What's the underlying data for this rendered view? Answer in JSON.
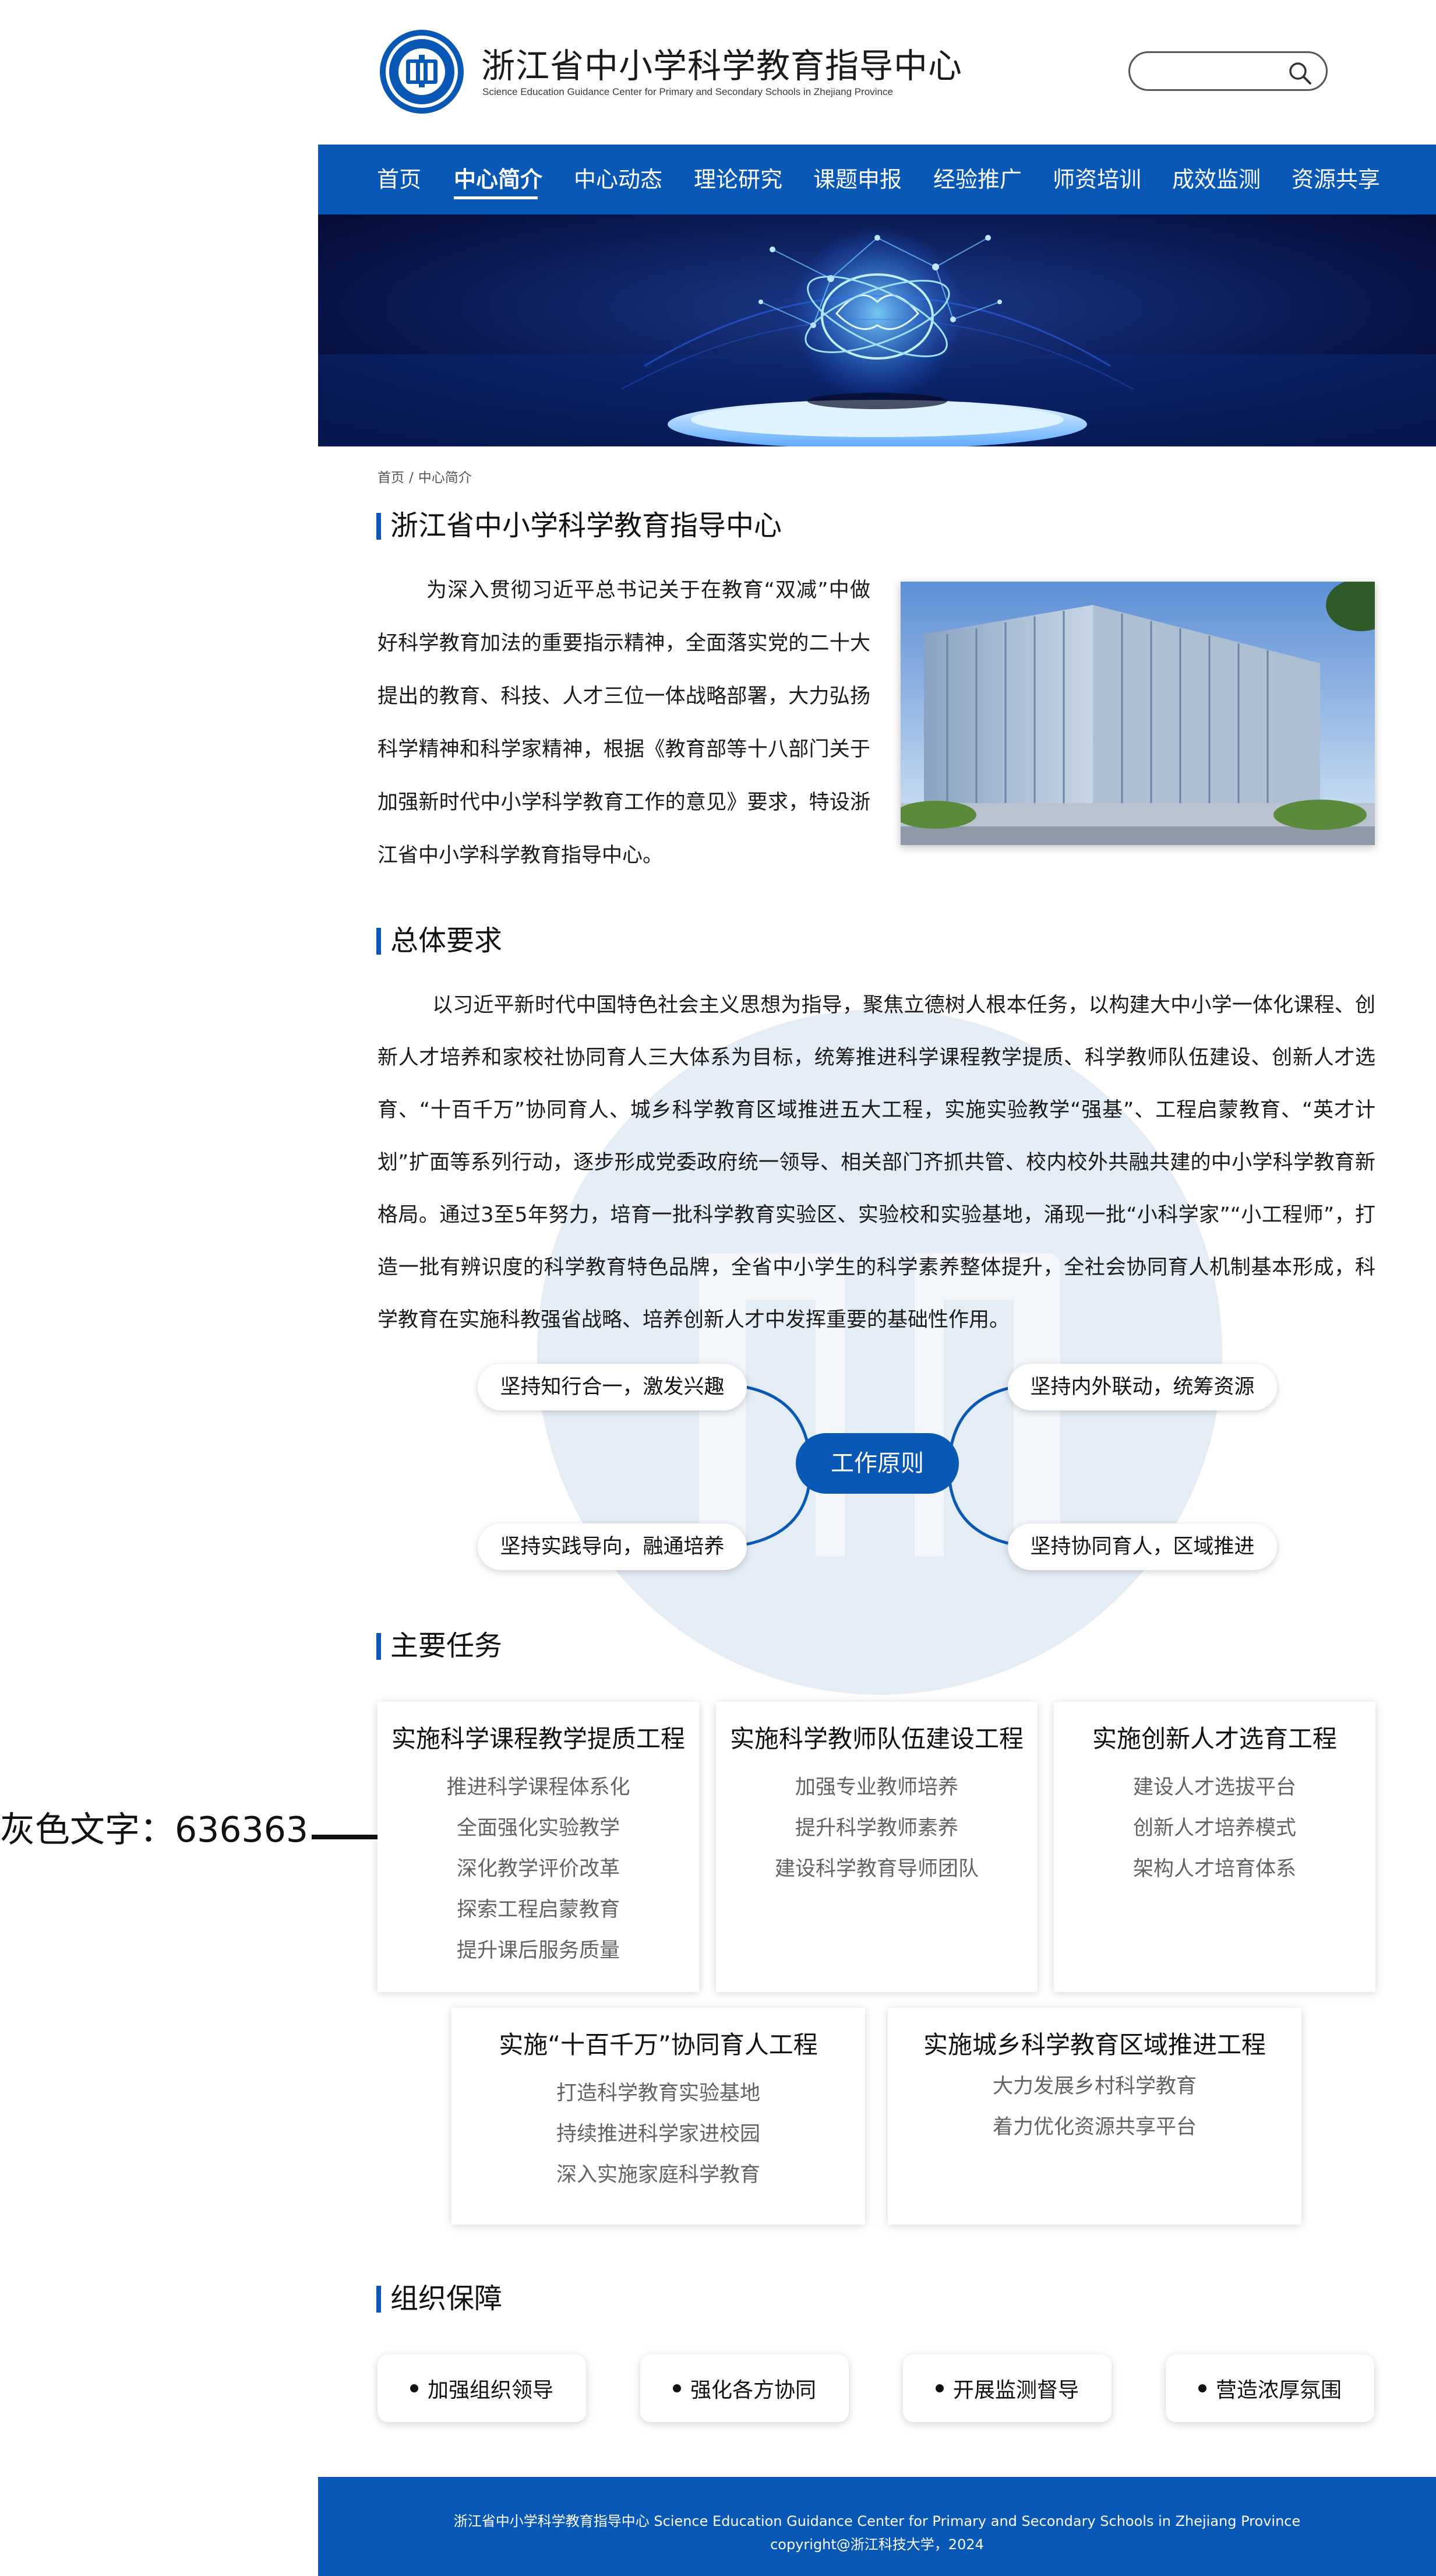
{
  "annotation": {
    "text": "灰色文字：636363"
  },
  "header": {
    "title": "浙江省中小学科学教育指导中心",
    "subtitle": "Science Education Guidance Center for Primary and Secondary Schools in Zhejiang Province",
    "search": {
      "value": "",
      "placeholder": ""
    }
  },
  "nav": {
    "items": [
      "首页",
      "中心简介",
      "中心动态",
      "理论研究",
      "课题申报",
      "经验推广",
      "师资培训",
      "成效监测",
      "资源共享"
    ],
    "active_index": 1
  },
  "breadcrumb": {
    "home": "首页",
    "separator": "/",
    "current": "中心简介"
  },
  "intro": {
    "title": "浙江省中小学科学教育指导中心",
    "text": "为深入贯彻习近平总书记关于在教育“双减”中做好科学教育加法的重要指示精神，全面落实党的二十大提出的教育、科技、人才三位一体战略部署，大力弘扬科学精神和科学家精神，根据《教育部等十八部门关于加强新时代中小学科学教育工作的意见》要求，特设浙江省中小学科学教育指导中心。"
  },
  "requirements": {
    "title": "总体要求",
    "text": "以习近平新时代中国特色社会主义思想为指导，聚焦立德树人根本任务，以构建大中小学一体化课程、创新人才培养和家校社协同育人三大体系为目标，统筹推进科学课程教学提质、科学教师队伍建设、创新人才选育、“十百千万”协同育人、城乡科学教育区域推进五大工程，实施实验教学“强基”、工程启蒙教育、“英才计划”扩面等系列行动，逐步形成党委政府统一领导、相关部门齐抓共管、校内校外共融共建的中小学科学教育新格局。通过3至5年努力，培育一批科学教育实验区、实验校和实验基地，涌现一批“小科学家”“小工程师”，打造一批有辨识度的科学教育特色品牌，全省中小学生的科学素养整体提升，全社会协同育人机制基本形成，科学教育在实施科教强省战略、培养创新人才中发挥重要的基础性作用。"
  },
  "principles": {
    "center": "工作原则",
    "top_left": "坚持知行合一，激发兴趣",
    "top_right": "坚持内外联动，统筹资源",
    "bottom_left": "坚持实践导向，融通培养",
    "bottom_right": "坚持协同育人，区域推进"
  },
  "tasks": {
    "title": "主要任务",
    "cards": [
      {
        "title": "实施科学课程教学提质工程",
        "items": [
          "推进科学课程体系化",
          "全面强化实验教学",
          "深化教学评价改革",
          "探索工程启蒙教育",
          "提升课后服务质量"
        ]
      },
      {
        "title": "实施科学教师队伍建设工程",
        "items": [
          "加强专业教师培养",
          "提升科学教师素养",
          "建设科学教育导师团队"
        ]
      },
      {
        "title": "实施创新人才选育工程",
        "items": [
          "建设人才选拔平台",
          "创新人才培养模式",
          "架构人才培育体系"
        ]
      },
      {
        "title": "实施“十百千万”协同育人工程",
        "items": [
          "打造科学教育实验基地",
          "持续推进科学家进校园",
          "深入实施家庭科学教育"
        ]
      },
      {
        "title": "实施城乡科学教育区域推进工程",
        "items": [
          "大力发展乡村科学教育",
          "着力优化资源共享平台"
        ]
      }
    ],
    "item_color": "#636363"
  },
  "guarantees": {
    "title": "组织保障",
    "items": [
      "加强组织领导",
      "强化各方协同",
      "开展监测督导",
      "营造浓厚氛围"
    ]
  },
  "footer": {
    "line1": "浙江省中小学科学教育指导中心  Science Education Guidance Center for Primary and Secondary Schools in Zhejiang Province",
    "line2": "copyright@浙江科技大学，2024"
  },
  "colors": {
    "brand_blue": "#0a58b5",
    "body_text": "#1a1a1a",
    "gray_text": "#636363",
    "watermark": "#e4ecf6"
  },
  "icons": [
    "logo-emblem",
    "search-icon",
    "arrow-right-icon",
    "brain-network-banner"
  ]
}
